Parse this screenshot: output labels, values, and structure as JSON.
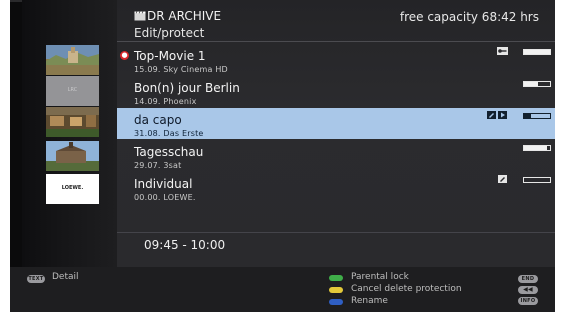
{
  "header": {
    "title": "DR ARCHIVE",
    "subtitle": "Edit/protect",
    "capacity": "free capacity 68:42 hrs"
  },
  "thumbnails": [
    {
      "name": "thumb-top-movie"
    },
    {
      "name": "thumb-bonjour-berlin",
      "caption": "LRC"
    },
    {
      "name": "thumb-da-capo"
    },
    {
      "name": "thumb-tagesschau"
    },
    {
      "name": "thumb-individual",
      "caption": "LOEWE."
    }
  ],
  "recordings": [
    {
      "title": "Top-Movie 1",
      "meta": "15.09.   Sky Cinema HD",
      "locked": true,
      "progress": 1.0,
      "icons": [
        "key-icon"
      ],
      "selected": false
    },
    {
      "title": "Bon(n) jour Berlin",
      "meta": "14.09.   Phoenix",
      "locked": false,
      "progress": 0.55,
      "icons": [],
      "selected": false
    },
    {
      "title": "da capo",
      "meta": "31.08.   Das Erste",
      "locked": false,
      "progress": 0.25,
      "icons": [
        "edit-icon",
        "play-icon"
      ],
      "selected": true
    },
    {
      "title": "Tagesschau",
      "meta": "29.07.   3sat",
      "locked": false,
      "progress": 0.9,
      "icons": [],
      "selected": false
    },
    {
      "title": "Individual",
      "meta": "00.00.   LOEWE.",
      "locked": false,
      "progress": 0.0,
      "icons": [
        "edit-icon"
      ],
      "selected": false
    }
  ],
  "time_slot": "09:45 - 10:00",
  "footer": {
    "text_key": "TEXT",
    "detail_label": "Detail",
    "green_label": "Parental lock",
    "yellow_label": "Cancel delete protection",
    "blue_label": "Rename",
    "end_key": "END",
    "info_key": "INFO",
    "colors": {
      "green": "#3fae49",
      "yellow": "#e3c93a",
      "blue": "#2f5fc4",
      "selection": "#a9c7e8"
    }
  }
}
